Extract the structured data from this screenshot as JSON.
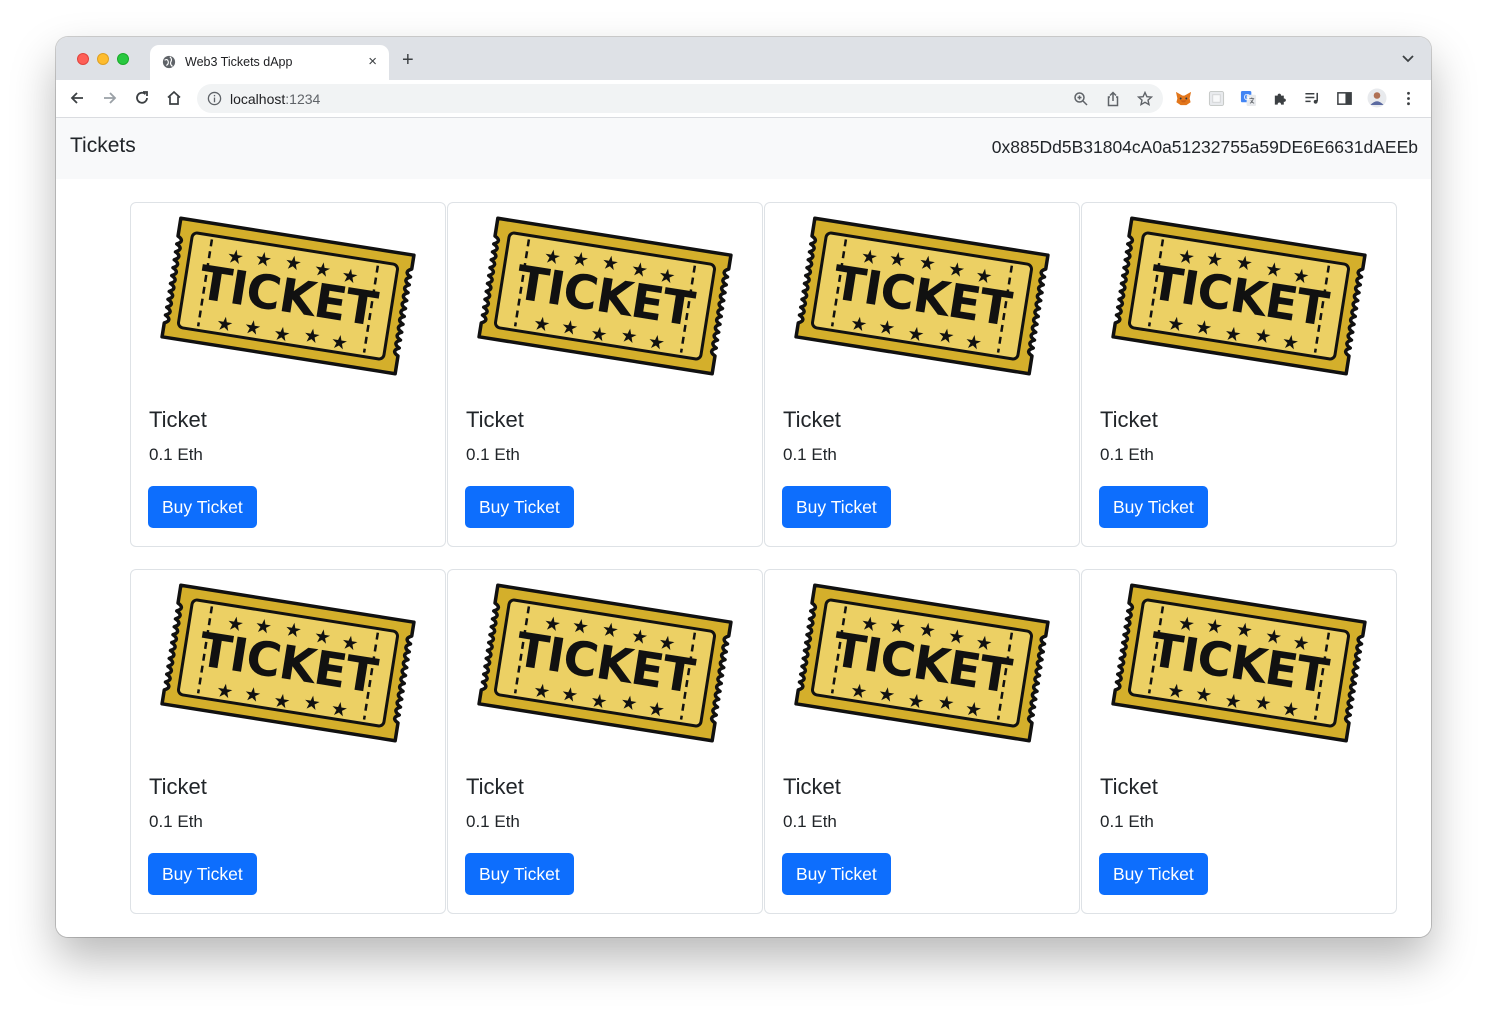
{
  "browser": {
    "tab_title": "Web3 Tickets dApp",
    "tab_close": "×",
    "new_tab": "+",
    "url_host": "localhost",
    "url_port": ":1234"
  },
  "navbar": {
    "brand": "Tickets",
    "account": "0x885Dd5B31804cA0a51232755a59DE6E6631dAEEb"
  },
  "tickets": [
    {
      "title": "Ticket",
      "price": "0.1 Eth",
      "button": "Buy Ticket",
      "image_text": "TICKET"
    },
    {
      "title": "Ticket",
      "price": "0.1 Eth",
      "button": "Buy Ticket",
      "image_text": "TICKET"
    },
    {
      "title": "Ticket",
      "price": "0.1 Eth",
      "button": "Buy Ticket",
      "image_text": "TICKET"
    },
    {
      "title": "Ticket",
      "price": "0.1 Eth",
      "button": "Buy Ticket",
      "image_text": "TICKET"
    },
    {
      "title": "Ticket",
      "price": "0.1 Eth",
      "button": "Buy Ticket",
      "image_text": "TICKET"
    },
    {
      "title": "Ticket",
      "price": "0.1 Eth",
      "button": "Buy Ticket",
      "image_text": "TICKET"
    },
    {
      "title": "Ticket",
      "price": "0.1 Eth",
      "button": "Buy Ticket",
      "image_text": "TICKET"
    },
    {
      "title": "Ticket",
      "price": "0.1 Eth",
      "button": "Buy Ticket",
      "image_text": "TICKET"
    }
  ],
  "colors": {
    "primary_button": "#0d6efd",
    "navbar_bg": "#f8f9fa",
    "ticket_yellow": "#ecd064"
  }
}
